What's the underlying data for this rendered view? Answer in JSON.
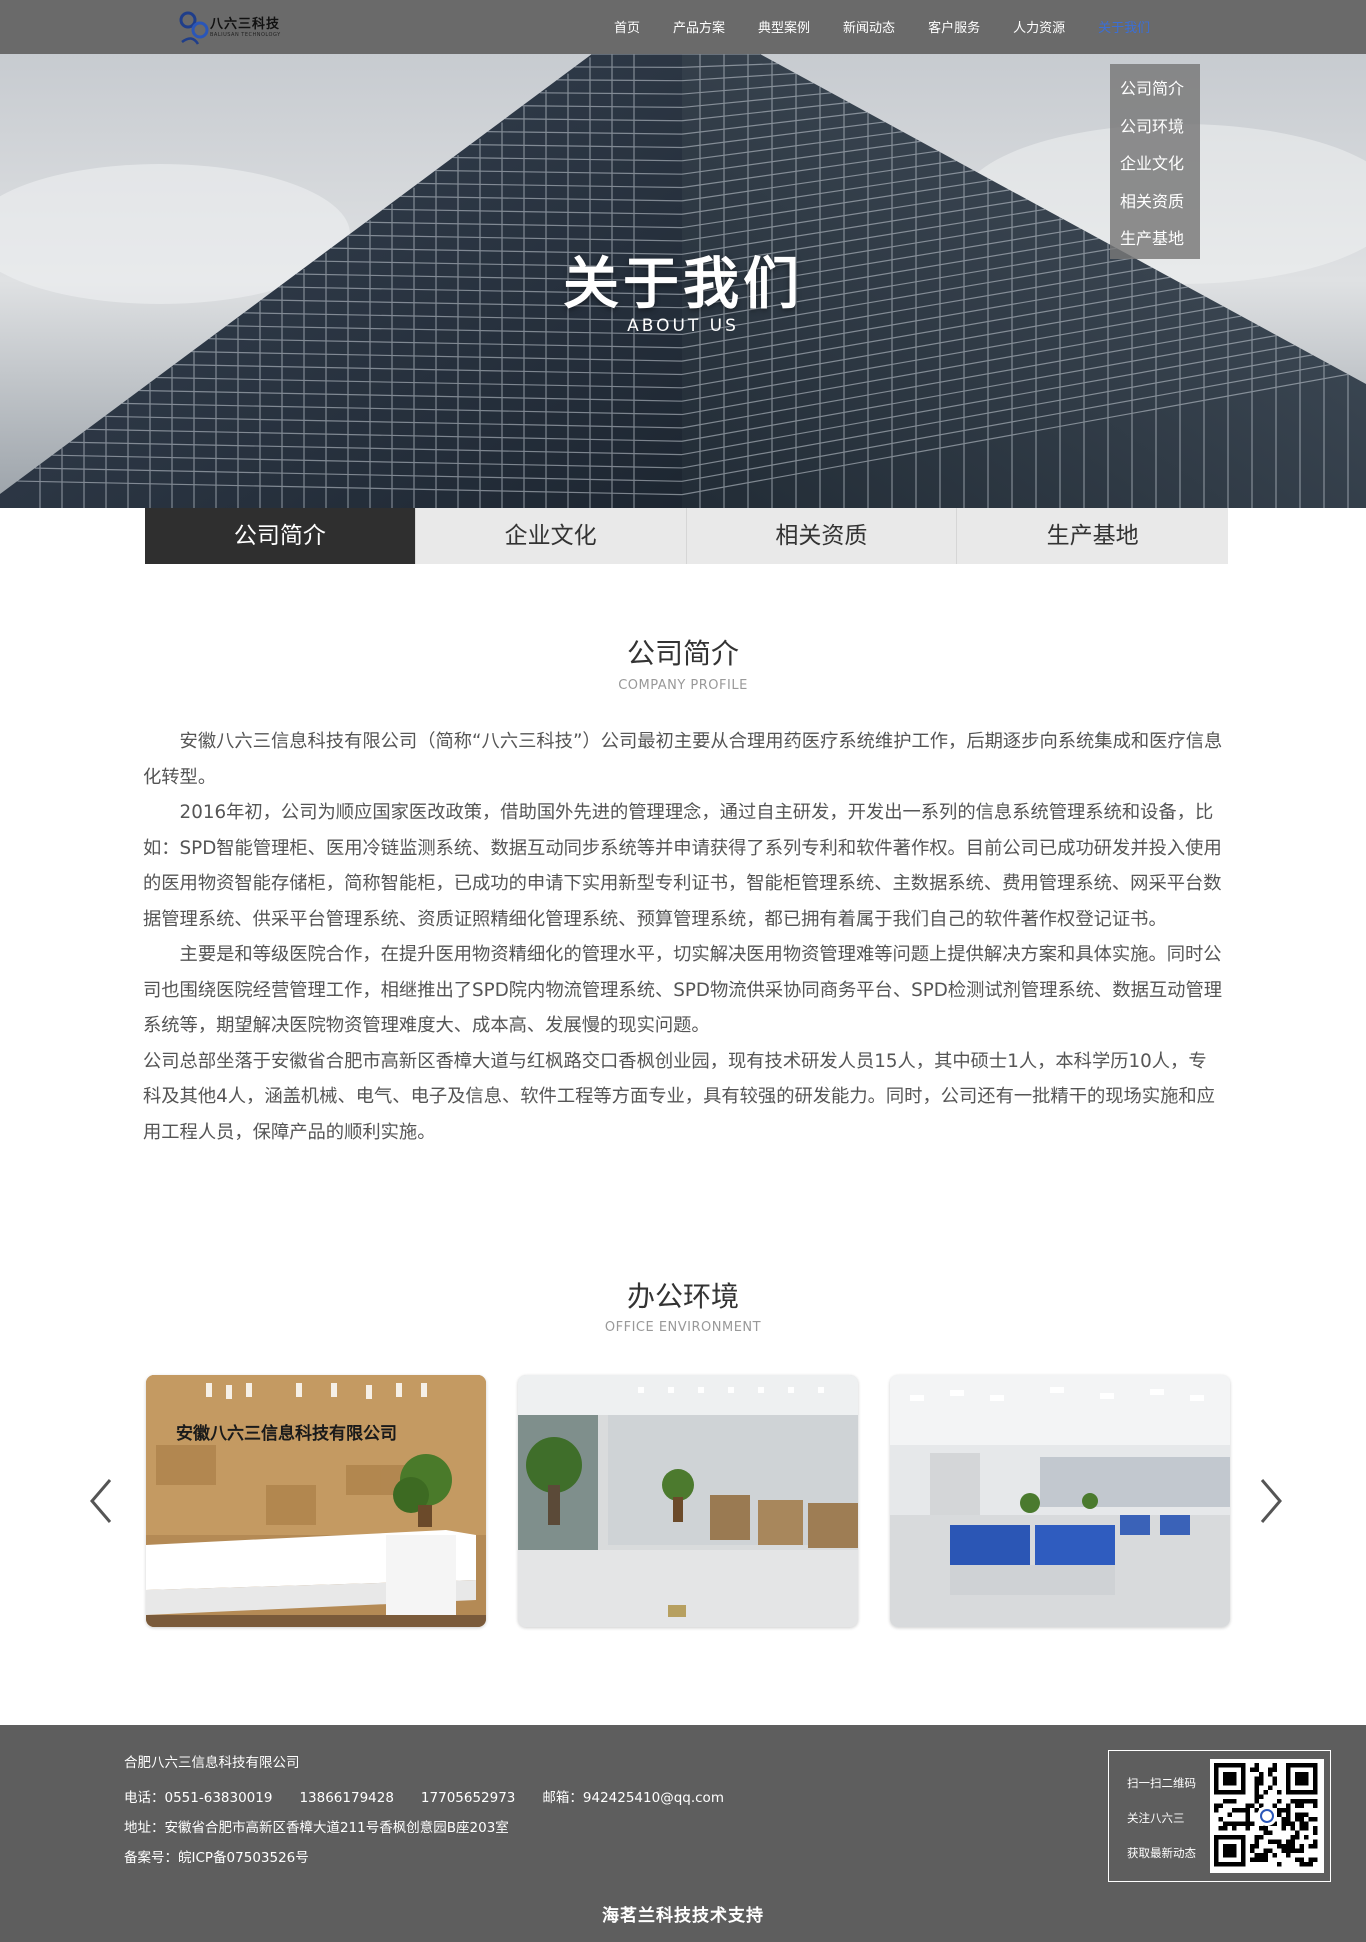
{
  "header": {
    "logo_text": "八六三科技",
    "logo_sub": "BALIUSAN TECHNOLOGY",
    "nav": [
      "首页",
      "产品方案",
      "典型案例",
      "新闻动态",
      "客户服务",
      "人力资源",
      "关于我们"
    ],
    "active_color": "#3b6fd6"
  },
  "dropdown": [
    "公司简介",
    "公司环境",
    "企业文化",
    "相关资质",
    "生产基地"
  ],
  "hero": {
    "title": "关于我们",
    "subtitle": "ABOUT US"
  },
  "tabs": [
    "公司简介",
    "企业文化",
    "相关资质",
    "生产基地"
  ],
  "profile": {
    "title": "公司简介",
    "subtitle": "COMPANY PROFILE",
    "paragraphs": [
      "　　安徽八六三信息科技有限公司（简称“八六三科技”）公司最初主要从合理用药医疗系统维护工作，后期逐步向系统集成和医疗信息化转型。",
      "　　2016年初，公司为顺应国家医改政策，借助国外先进的管理理念，通过自主研发，开发出一系列的信息系统管理系统和设备，比如：SPD智能管理柜、医用冷链监测系统、数据互动同步系统等并申请获得了系列专利和软件著作权。目前公司已成功研发并投入使用的医用物资智能存储柜，简称智能柜，已成功的申请下实用新型专利证书，智能柜管理系统、主数据系统、费用管理系统、网采平台数据管理系统、供采平台管理系统、资质证照精细化管理系统、预算管理系统，都已拥有着属于我们自己的软件著作权登记证书。",
      "　　主要是和等级医院合作，在提升医用物资精细化的管理水平，切实解决医用物资管理难等问题上提供解决方案和具体实施。同时公司也围绕医院经营管理工作，相继推出了SPD院内物流管理系统、SPD物流供采协同商务平台、SPD检测试剂管理系统、数据互动管理系统等，期望解决医院物资管理难度大、成本高、发展慢的现实问题。",
      "公司总部坐落于安徽省合肥市高新区香樟大道与红枫路交口香枫创业园，现有技术研发人员15人，其中硕士1人，本科学历10人，专科及其他4人，涵盖机械、电气、电子及信息、软件工程等方面专业，具有较强的研发能力。同时，公司还有一批精干的现场实施和应用工程人员，保障产品的顺利实施。"
    ]
  },
  "office": {
    "title": "办公环境",
    "subtitle": "OFFICE ENVIRONMENT",
    "sign_text": "安徽八六三信息科技有限公司"
  },
  "footer": {
    "company": "合肥八六三信息科技有限公司",
    "phone": "电话：0551-63830019　　13866179428　　17705652973　　邮箱：942425410@qq.com",
    "address": "地址：安徽省合肥市高新区香樟大道211号香枫创意园B座203室",
    "icp": "备案号：皖ICP备07503526号",
    "qr_lines": [
      "扫一扫二维码",
      "关注八六三",
      "获取最新动态"
    ],
    "support": "海茗兰科技技术支持"
  }
}
